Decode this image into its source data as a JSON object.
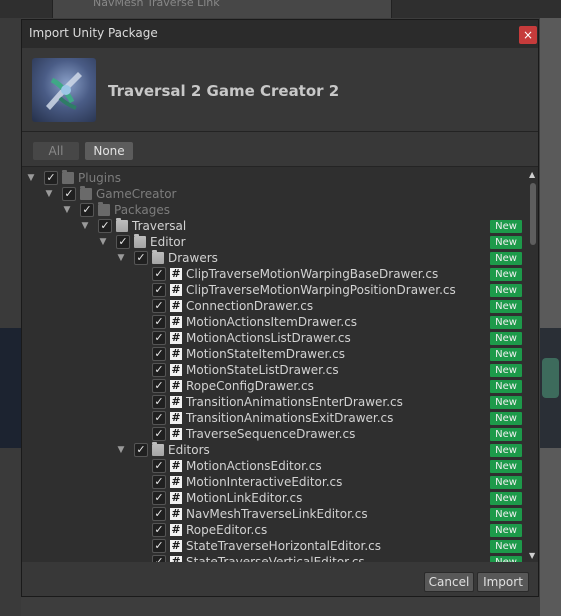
{
  "background": {
    "window_title": "NavMesh Traverse Link"
  },
  "dialog": {
    "title": "Import Unity Package",
    "close_glyph": "×",
    "package_title": "Traversal 2 Game Creator 2",
    "all_label": "All",
    "none_label": "None",
    "cancel_label": "Cancel",
    "import_label": "Import",
    "new_badge_label": "New",
    "badge_color": "#1d9a4a",
    "close_color": "#c63b3b"
  },
  "tree": [
    {
      "depth": 0,
      "name": "Plugins",
      "type": "folder",
      "dim": true,
      "new": false
    },
    {
      "depth": 1,
      "name": "GameCreator",
      "type": "folder",
      "dim": true,
      "new": false
    },
    {
      "depth": 2,
      "name": "Packages",
      "type": "folder",
      "dim": true,
      "new": false
    },
    {
      "depth": 3,
      "name": "Traversal",
      "type": "folder",
      "dim": false,
      "new": true
    },
    {
      "depth": 4,
      "name": "Editor",
      "type": "folder",
      "dim": false,
      "new": true
    },
    {
      "depth": 5,
      "name": "Drawers",
      "type": "folder",
      "dim": false,
      "new": true
    },
    {
      "depth": 6,
      "name": "ClipTraverseMotionWarpingBaseDrawer.cs",
      "type": "script",
      "dim": false,
      "new": true
    },
    {
      "depth": 6,
      "name": "ClipTraverseMotionWarpingPositionDrawer.cs",
      "type": "script",
      "dim": false,
      "new": true
    },
    {
      "depth": 6,
      "name": "ConnectionDrawer.cs",
      "type": "script",
      "dim": false,
      "new": true
    },
    {
      "depth": 6,
      "name": "MotionActionsItemDrawer.cs",
      "type": "script",
      "dim": false,
      "new": true
    },
    {
      "depth": 6,
      "name": "MotionActionsListDrawer.cs",
      "type": "script",
      "dim": false,
      "new": true
    },
    {
      "depth": 6,
      "name": "MotionStateItemDrawer.cs",
      "type": "script",
      "dim": false,
      "new": true
    },
    {
      "depth": 6,
      "name": "MotionStateListDrawer.cs",
      "type": "script",
      "dim": false,
      "new": true
    },
    {
      "depth": 6,
      "name": "RopeConfigDrawer.cs",
      "type": "script",
      "dim": false,
      "new": true
    },
    {
      "depth": 6,
      "name": "TransitionAnimationsEnterDrawer.cs",
      "type": "script",
      "dim": false,
      "new": true
    },
    {
      "depth": 6,
      "name": "TransitionAnimationsExitDrawer.cs",
      "type": "script",
      "dim": false,
      "new": true
    },
    {
      "depth": 6,
      "name": "TraverseSequenceDrawer.cs",
      "type": "script",
      "dim": false,
      "new": true
    },
    {
      "depth": 5,
      "name": "Editors",
      "type": "folder",
      "dim": false,
      "new": true
    },
    {
      "depth": 6,
      "name": "MotionActionsEditor.cs",
      "type": "script",
      "dim": false,
      "new": true
    },
    {
      "depth": 6,
      "name": "MotionInteractiveEditor.cs",
      "type": "script",
      "dim": false,
      "new": true
    },
    {
      "depth": 6,
      "name": "MotionLinkEditor.cs",
      "type": "script",
      "dim": false,
      "new": true
    },
    {
      "depth": 6,
      "name": "NavMeshTraverseLinkEditor.cs",
      "type": "script",
      "dim": false,
      "new": true
    },
    {
      "depth": 6,
      "name": "RopeEditor.cs",
      "type": "script",
      "dim": false,
      "new": true
    },
    {
      "depth": 6,
      "name": "StateTraverseHorizontalEditor.cs",
      "type": "script",
      "dim": false,
      "new": true
    },
    {
      "depth": 6,
      "name": "StateTraverseVerticalEditor.cs",
      "type": "script",
      "dim": false,
      "new": true
    }
  ]
}
